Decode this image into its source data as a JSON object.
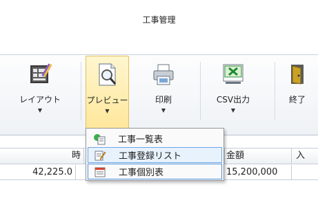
{
  "window": {
    "title": "工事管理"
  },
  "ribbon": {
    "buttons": [
      {
        "label": "レイアウト",
        "icon": "layout-icon",
        "has_dropdown": true
      },
      {
        "label": "プレビュー",
        "icon": "preview-magnifier-icon",
        "has_dropdown": true,
        "active": true
      },
      {
        "label": "印刷",
        "icon": "printer-icon",
        "has_dropdown": true
      },
      {
        "label": "CSV出力",
        "icon": "csv-export-icon",
        "has_dropdown": true
      },
      {
        "label": "終了",
        "icon": "exit-door-icon",
        "has_dropdown": false
      }
    ],
    "dropdown_arrow": "▼"
  },
  "preview_menu": {
    "items": [
      {
        "label": "工事一覧表",
        "icon": "list-report-icon"
      },
      {
        "label": "工事登録リスト",
        "icon": "register-list-icon"
      },
      {
        "label": "工事個別表",
        "icon": "individual-report-icon"
      }
    ]
  },
  "grid": {
    "headers": [
      "時",
      "金額",
      "入"
    ],
    "row": [
      "42,225.0",
      "15,200,000"
    ]
  }
}
